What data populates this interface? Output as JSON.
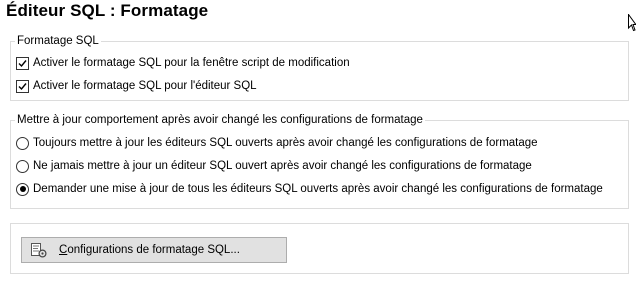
{
  "page": {
    "title": "Éditeur SQL : Formatage"
  },
  "formatting_group": {
    "legend": "Formatage SQL",
    "options": [
      {
        "label": "Activer le formatage SQL pour la fenêtre script de modification",
        "checked": true
      },
      {
        "label": "Activer le formatage SQL pour l'éditeur SQL",
        "checked": true
      }
    ]
  },
  "update_group": {
    "legend": "Mettre à jour comportement après avoir changé les configurations de formatage",
    "options": [
      {
        "label": "Toujours mettre à jour les éditeurs SQL ouverts après avoir changé les configurations de formatage",
        "selected": false
      },
      {
        "label": "Ne jamais mettre à jour un éditeur SQL ouvert après avoir changé les configurations de formatage",
        "selected": false
      },
      {
        "label": "Demander une mise à jour de tous les éditeurs SQL ouverts après avoir changé les configurations de formatage",
        "selected": true
      }
    ]
  },
  "config_button": {
    "accel": "C",
    "label_rest": "onfigurations de formatage SQL..."
  },
  "icons": {
    "cursor": "mouse-pointer-icon",
    "button": "formatting-config-icon"
  }
}
